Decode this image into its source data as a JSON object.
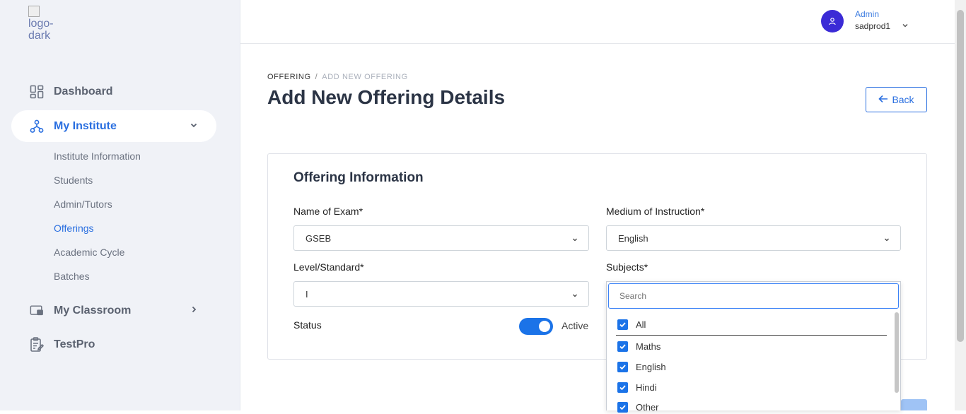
{
  "app": {
    "logo_alt": "logo-dark"
  },
  "sidebar": {
    "items": [
      {
        "label": "Dashboard",
        "icon": "dashboard-icon"
      },
      {
        "label": "My Institute",
        "icon": "hierarchy-icon",
        "expanded": true
      },
      {
        "label": "My Classroom",
        "icon": "classroom-icon"
      },
      {
        "label": "TestPro",
        "icon": "clipboard-edit-icon"
      }
    ],
    "sub_items": [
      "Institute Information",
      "Students",
      "Admin/Tutors",
      "Offerings",
      "Academic Cycle",
      "Batches"
    ],
    "active_sub_item": "Offerings"
  },
  "header": {
    "user_role": "Admin",
    "user_name": "sadprod1"
  },
  "breadcrumb": {
    "parent": "OFFERING",
    "separator": "/",
    "current": "ADD NEW OFFERING"
  },
  "page": {
    "title": "Add New Offering Details",
    "back_label": "Back"
  },
  "form": {
    "section_title": "Offering Information",
    "exam_label": "Name of Exam*",
    "exam_value": "GSEB",
    "medium_label": "Medium of Instruction*",
    "medium_value": "English",
    "level_label": "Level/Standard*",
    "level_value": "I",
    "subjects_label": "Subjects*",
    "status_label": "Status",
    "status_value": "Active",
    "status_on": true
  },
  "subjects_dropdown": {
    "search_placeholder": "Search",
    "options": [
      {
        "label": "All",
        "checked": true
      },
      {
        "label": "Maths",
        "checked": true
      },
      {
        "label": "English",
        "checked": true
      },
      {
        "label": "Hindi",
        "checked": true
      },
      {
        "label": "Other",
        "checked": true
      }
    ]
  },
  "colors": {
    "accent": "#2a6fe0",
    "avatar": "#3b2bd6",
    "toggle_on": "#1b73e8",
    "sidebar_bg": "#f0f2f7"
  }
}
